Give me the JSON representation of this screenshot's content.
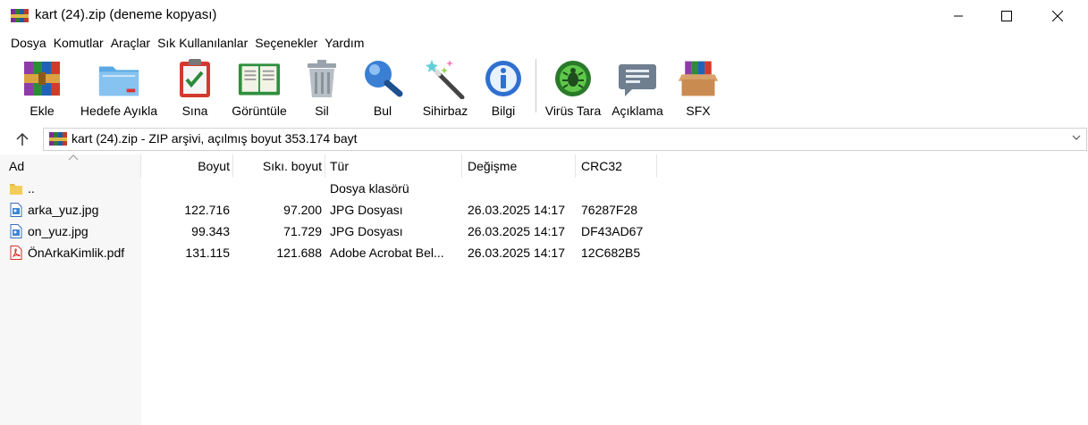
{
  "window": {
    "title": "kart (24).zip (deneme kopyası)"
  },
  "menu": [
    "Dosya",
    "Komutlar",
    "Araçlar",
    "Sık Kullanılanlar",
    "Seçenekler",
    "Yardım"
  ],
  "toolbar": [
    {
      "label": "Ekle",
      "icon": "add-archive-icon"
    },
    {
      "label": "Hedefe Ayıkla",
      "icon": "extract-folder-icon"
    },
    {
      "label": "Sına",
      "icon": "test-clipboard-icon"
    },
    {
      "label": "Görüntüle",
      "icon": "view-book-icon"
    },
    {
      "label": "Sil",
      "icon": "trash-icon"
    },
    {
      "label": "Bul",
      "icon": "magnifier-icon"
    },
    {
      "label": "Sihirbaz",
      "icon": "wizard-wand-icon"
    },
    {
      "label": "Bilgi",
      "icon": "info-icon"
    },
    {
      "label": "Virüs Tara",
      "icon": "virus-scan-icon"
    },
    {
      "label": "Açıklama",
      "icon": "comment-icon"
    },
    {
      "label": "SFX",
      "icon": "sfx-box-icon"
    }
  ],
  "address": {
    "text": "kart (24).zip - ZIP arşivi, açılmış boyut 353.174 bayt"
  },
  "columns": [
    "Ad",
    "Boyut",
    "Sıkı. boyut",
    "Tür",
    "Değişme",
    "CRC32"
  ],
  "files": [
    {
      "name": "..",
      "size": "",
      "packed": "",
      "type": "Dosya klasörü",
      "modified": "",
      "crc": "",
      "icon": "folder-icon"
    },
    {
      "name": "arka_yuz.jpg",
      "size": "122.716",
      "packed": "97.200",
      "type": "JPG Dosyası",
      "modified": "26.03.2025 14:17",
      "crc": "76287F28",
      "icon": "image-file-icon"
    },
    {
      "name": "on_yuz.jpg",
      "size": "99.343",
      "packed": "71.729",
      "type": "JPG Dosyası",
      "modified": "26.03.2025 14:17",
      "crc": "DF43AD67",
      "icon": "image-file-icon"
    },
    {
      "name": "ÖnArkaKimlik.pdf",
      "size": "131.115",
      "packed": "121.688",
      "type": "Adobe Acrobat Bel...",
      "modified": "26.03.2025 14:17",
      "crc": "12C682B5",
      "icon": "pdf-file-icon"
    }
  ]
}
